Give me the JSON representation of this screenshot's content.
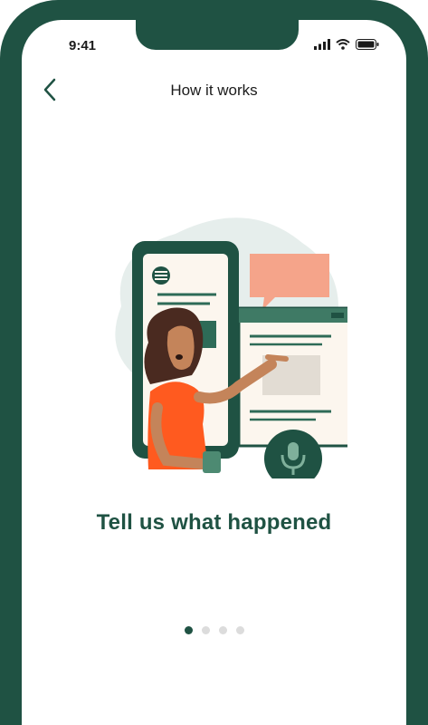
{
  "status_bar": {
    "time": "9:41",
    "icons": [
      "signal-icon",
      "wifi-icon",
      "battery-icon"
    ]
  },
  "header": {
    "back_icon": "chevron-left-icon",
    "title": "How it works"
  },
  "main": {
    "illustration": "person-phone-voice-illustration",
    "headline": "Tell us what happened"
  },
  "pager": {
    "total": 4,
    "active_index": 0
  },
  "colors": {
    "brand_green": "#1f5243",
    "accent_orange": "#ff5a1f",
    "accent_salmon": "#f5a48a",
    "pale_blue": "#e6eeec",
    "dot_inactive": "#dcdcdc"
  }
}
